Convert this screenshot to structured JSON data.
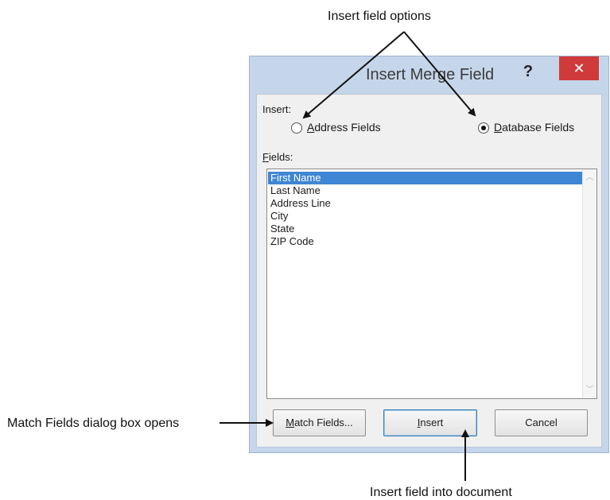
{
  "annotations": {
    "top": "Insert field options",
    "left": "Match Fields dialog box opens",
    "bottom": "Insert field into document"
  },
  "dialog": {
    "title": "Insert Merge Field",
    "help_glyph": "?",
    "close_glyph": "✕",
    "insert_label": "Insert:",
    "radio_options": [
      {
        "accel": "A",
        "rest": "ddress Fields",
        "selected": false
      },
      {
        "accel": "D",
        "rest": "atabase Fields",
        "selected": true
      }
    ],
    "fields_label": {
      "accel": "F",
      "rest": "ields:"
    },
    "fields": [
      "First Name",
      "Last Name",
      "Address Line",
      "City",
      "State",
      "ZIP Code"
    ],
    "selected_field": "First Name",
    "buttons": {
      "match_fields": {
        "accel": "M",
        "rest": "atch Fields..."
      },
      "insert": {
        "accel": "I",
        "rest": "nsert"
      },
      "cancel": "Cancel"
    },
    "colors": {
      "frame": "#c6d6ea",
      "close": "#d13a3a",
      "selection": "#3f86d5"
    }
  }
}
